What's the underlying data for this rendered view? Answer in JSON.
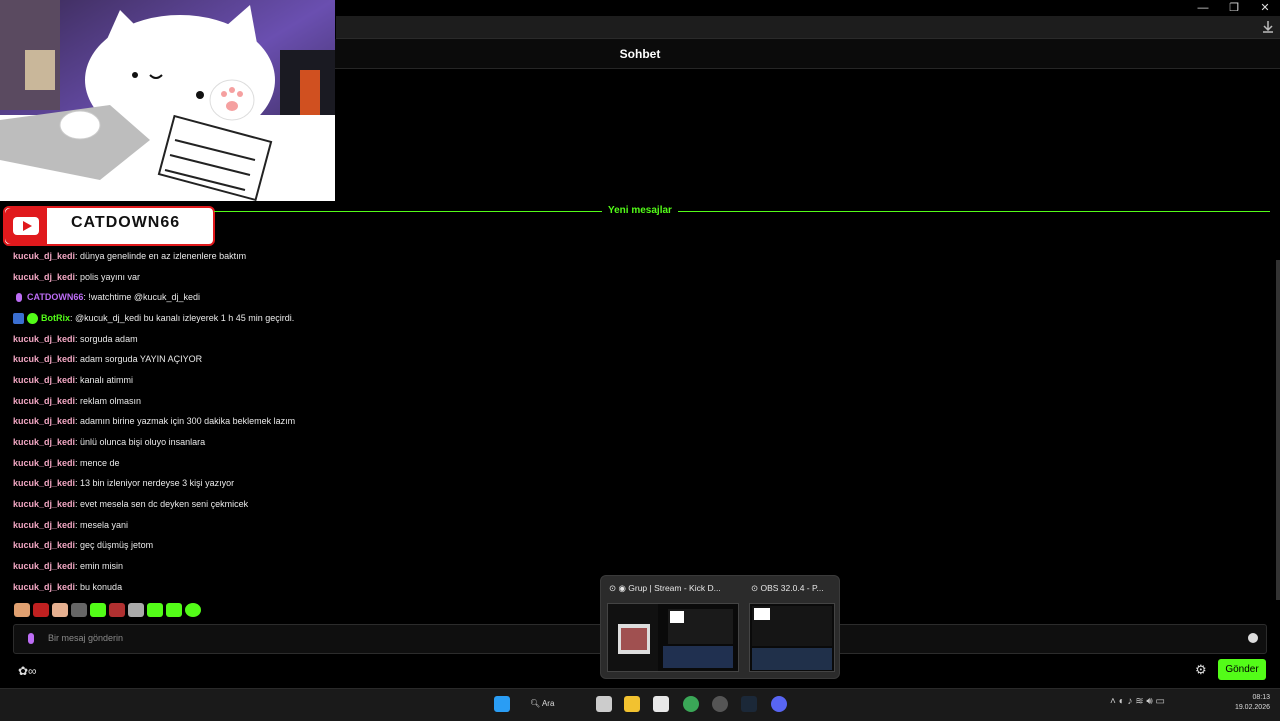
{
  "chat": {
    "title": "Sohbet",
    "new_messages_label": "Yeni mesajlar",
    "messages": [
      {
        "user": "kucuk_dj_kedi",
        "text": ": dünya genelinde en az izlenenlere baktım"
      },
      {
        "user": "kucuk_dj_kedi",
        "text": ": polis yayını var"
      },
      {
        "user": "CATDOWN66",
        "text": ": !watchtime @kucuk_dj_kedi"
      },
      {
        "user": "BotRix",
        "text": ": @kucuk_dj_kedi bu kanalı izleyerek 1 h 45 min geçirdi."
      },
      {
        "user": "kucuk_dj_kedi",
        "text": ": sorguda adam"
      },
      {
        "user": "kucuk_dj_kedi",
        "text": ": adam sorguda YAYIN AÇIYOR"
      },
      {
        "user": "kucuk_dj_kedi",
        "text": ": kanalı atimmi"
      },
      {
        "user": "kucuk_dj_kedi",
        "text": ": reklam olmasın"
      },
      {
        "user": "kucuk_dj_kedi",
        "text": ": adamın birine yazmak için 300 dakika beklemek lazım"
      },
      {
        "user": "kucuk_dj_kedi",
        "text": ": ünlü olunca bişi oluyo insanlara"
      },
      {
        "user": "kucuk_dj_kedi",
        "text": ": mence de"
      },
      {
        "user": "kucuk_dj_kedi",
        "text": ": 13 bin izleniyor nerdeyse 3 kişi yazıyor"
      },
      {
        "user": "kucuk_dj_kedi",
        "text": ": evet mesela sen dc deyken seni çekmicek"
      },
      {
        "user": "kucuk_dj_kedi",
        "text": ": mesela yani"
      },
      {
        "user": "kucuk_dj_kedi",
        "text": ": geç düşmüş jetom"
      },
      {
        "user": "kucuk_dj_kedi",
        "text": ": emin misin"
      },
      {
        "user": "kucuk_dj_kedi",
        "text": ": bu konuda"
      }
    ],
    "input_placeholder": "Bir mesaj gönderin",
    "send_label": "Gönder"
  },
  "overlay": {
    "channel_name": "CATDOWN66"
  },
  "taskbar": {
    "search_label": "Ara",
    "time": "08:13",
    "date": "19.02.2026"
  },
  "preview": {
    "window1_title": "Grup | Stream - Kick D...",
    "window2_title": "OBS 32.0.4 - P..."
  },
  "colors": {
    "accent": "#53fc18",
    "username": "#f2a7c3",
    "broadcaster": "#bd6df5"
  }
}
